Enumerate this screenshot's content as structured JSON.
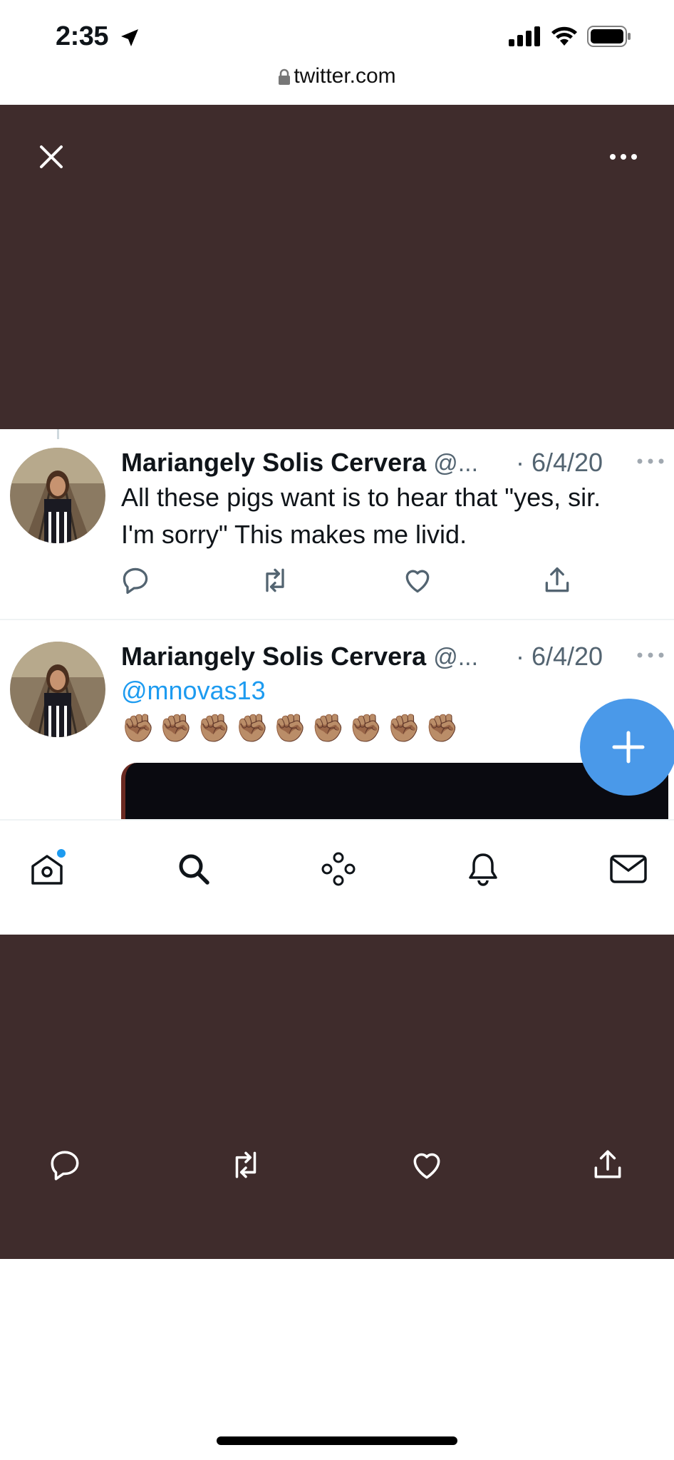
{
  "status_bar": {
    "time": "2:35",
    "icons": [
      "location-arrow-icon",
      "signal-icon",
      "wifi-icon",
      "battery-icon"
    ]
  },
  "browser": {
    "url": "twitter.com",
    "icon": "lock-icon"
  },
  "viewer": {
    "close_icon": "close-icon",
    "more_icon": "more-horizontal-icon",
    "actions": [
      "reply-icon",
      "retweet-icon",
      "like-icon",
      "share-icon"
    ]
  },
  "tweets": [
    {
      "name": "Mariangely Solis Cervera",
      "handle": "@...",
      "date": "· 6/4/20",
      "text_line1": "All these pigs want is to hear that \"yes, sir.",
      "text_line2": "I'm sorry\" This makes me livid."
    },
    {
      "name": "Mariangely Solis Cervera",
      "handle": "@...",
      "date": "· 6/4/20",
      "mention": "@mnovas13",
      "emoji": "✊🏽✊🏽✊🏽✊🏽✊🏽✊🏽✊🏽✊🏽✊🏽"
    }
  ],
  "tabbar": {
    "items": [
      "home-icon",
      "search-icon",
      "spaces-icon",
      "notifications-icon",
      "messages-icon"
    ]
  },
  "colors": {
    "viewer_background": "#3f2c2c",
    "accent": "#1d9bf0",
    "fab": "#4a99e9"
  }
}
